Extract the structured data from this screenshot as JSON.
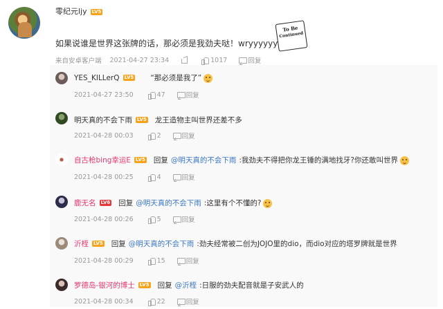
{
  "post": {
    "username": "零纪元ljy",
    "level": "LV5",
    "text": "如果说谁是世界这张牌的话，那必须是我劲夫哒！wryyyyyyyy",
    "sticker_line1": "To Be",
    "sticker_line2": "Continued",
    "source": "来自安卓客户端",
    "time": "2021-04-27 23:34",
    "likes": "1017",
    "reply_label": "回复"
  },
  "replies": [
    {
      "username": "YES_KILLerQ",
      "level": "LV5",
      "text": "“那必须是我了”",
      "time": "2021-04-27 23:50",
      "likes": "47",
      "reply_label": "回复"
    },
    {
      "username": "明天真的不会下雨",
      "level": "LV5",
      "text": "龙王造物主叫世界还差不多",
      "time": "2021-04-28 00:03",
      "likes": "2",
      "reply_label": "回复"
    },
    {
      "username": "自古枪bing幸运E",
      "level": "LV5",
      "reply_word": "回复",
      "mention": "@明天真的不会下雨",
      "text": ":我劲夫不得把你龙王锤的满地找牙?你还敢叫世界",
      "time": "2021-04-28 00:25",
      "likes": "4",
      "reply_label": "回复"
    },
    {
      "username": "鹿无名",
      "level": "LV6",
      "reply_word": "回复",
      "mention": "@明天真的不会下雨",
      "text": ":这里有个不懂的?",
      "time": "2021-04-28 00:26",
      "likes": "5",
      "reply_label": "回复"
    },
    {
      "username": "沂桎",
      "level": "LV5",
      "reply_word": "回复",
      "mention": "@明天真的不会下雨",
      "text": ":劲夫经常被二创为JOJO里的dio，而dio对应的塔罗牌就是世界",
      "time": "2021-04-28 00:29",
      "likes": "15",
      "reply_label": "回复"
    },
    {
      "username": "罗德岛-银河的博士",
      "level": "LV5",
      "reply_word": "回复",
      "mention": "@沂桎",
      "text": ":日服的劲夫配音就是子安武人的",
      "time": "2021-04-28 00:34",
      "likes": "22",
      "reply_label": "回复"
    }
  ]
}
